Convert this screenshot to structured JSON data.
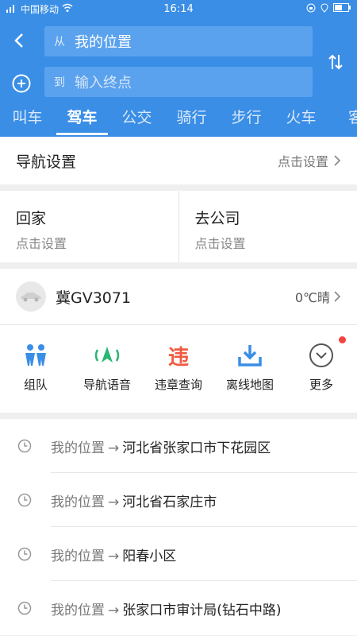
{
  "status_bar": {
    "carrier": "中国移动",
    "time": "16:14"
  },
  "search": {
    "from_prefix": "从",
    "from_value": "我的位置",
    "to_prefix": "到",
    "to_placeholder": "输入终点"
  },
  "tabs": [
    {
      "label": "叫车"
    },
    {
      "label": "驾车",
      "active": true
    },
    {
      "label": "公交"
    },
    {
      "label": "骑行"
    },
    {
      "label": "步行"
    },
    {
      "label": "火车"
    },
    {
      "label": "客"
    }
  ],
  "nav_settings": {
    "title": "导航设置",
    "action": "点击设置"
  },
  "shortcuts": {
    "home": {
      "title": "回家",
      "subtitle": "点击设置"
    },
    "work": {
      "title": "去公司",
      "subtitle": "点击设置"
    }
  },
  "car": {
    "plate": "冀GV3071",
    "weather": "0℃晴"
  },
  "tools": [
    {
      "label": "组队",
      "icon": "team-icon"
    },
    {
      "label": "导航语音",
      "icon": "voice-nav-icon"
    },
    {
      "label": "违章查询",
      "icon": "violation-icon",
      "glyph": "违"
    },
    {
      "label": "离线地图",
      "icon": "download-icon"
    },
    {
      "label": "更多",
      "icon": "more-icon"
    }
  ],
  "history": [
    {
      "from": "我的位置",
      "to": "河北省张家口市下花园区"
    },
    {
      "from": "我的位置",
      "to": "河北省石家庄市"
    },
    {
      "from": "我的位置",
      "to": "阳春小区"
    },
    {
      "from": "我的位置",
      "to": "张家口市审计局(钻石中路)"
    }
  ],
  "colors": {
    "brand_blue": "#3a8ee6",
    "accent_green": "#2bb673",
    "violation_red": "#f05a40",
    "badge_red": "#f2453d"
  }
}
